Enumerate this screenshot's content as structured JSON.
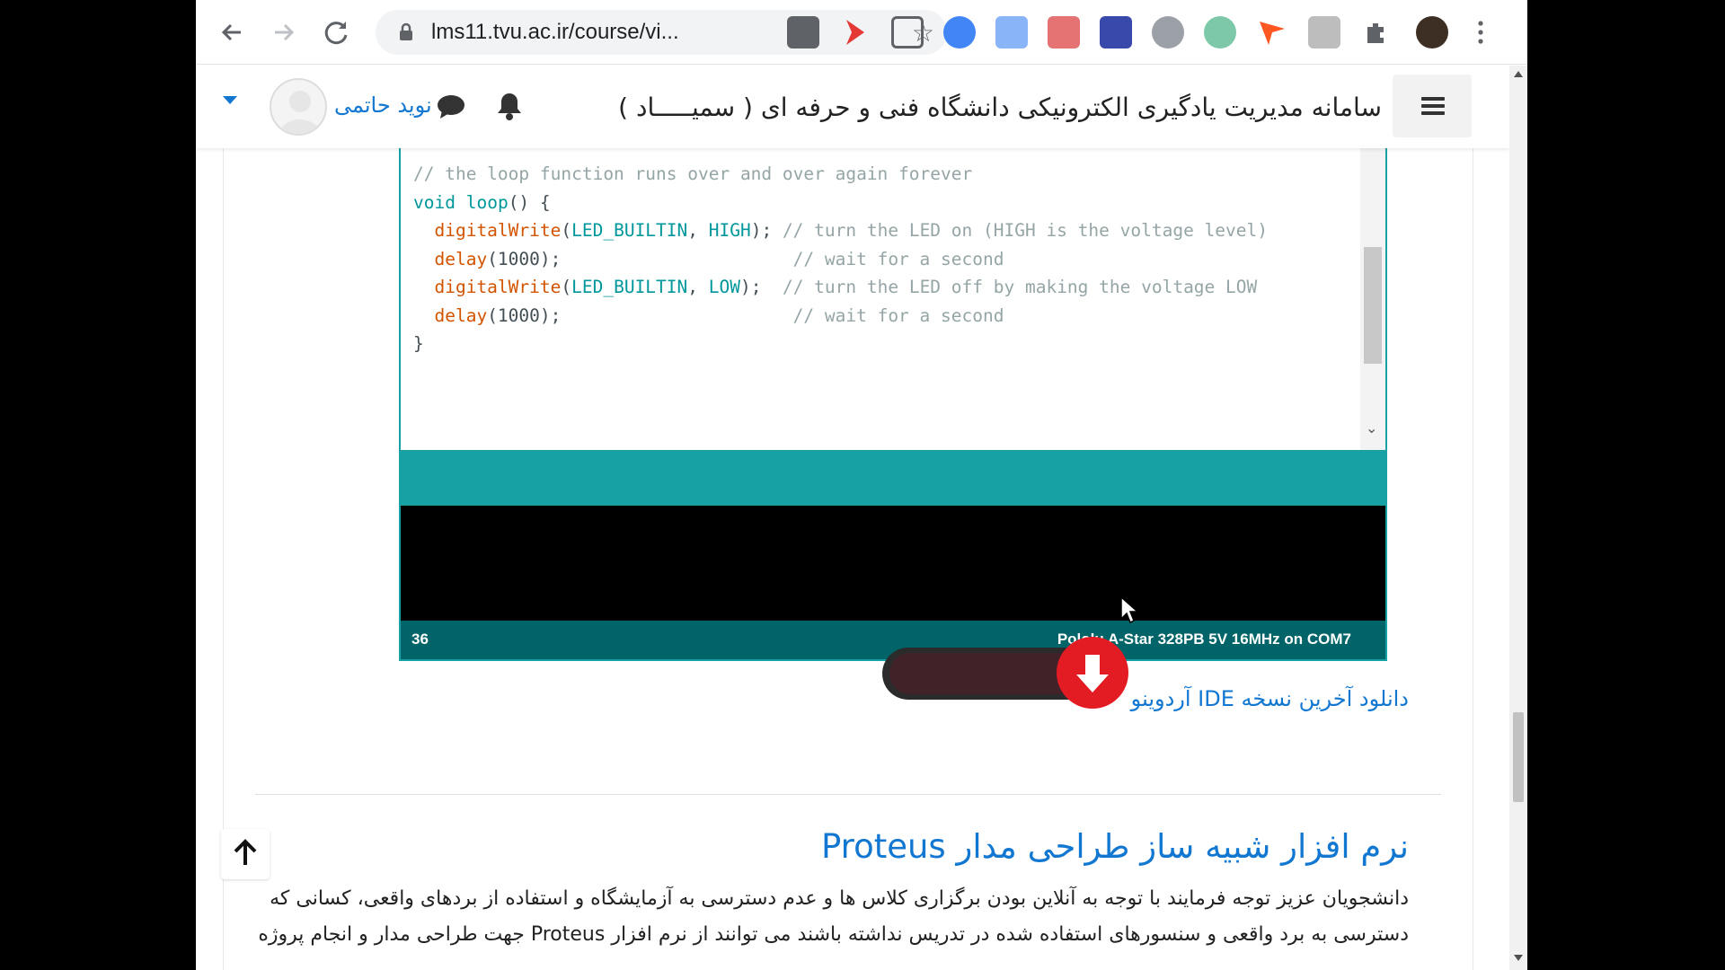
{
  "browser": {
    "url": "lms11.tvu.ac.ir/course/vi...",
    "icons": [
      "back-icon",
      "forward-icon",
      "reload-icon",
      "lock-icon",
      "star-icon",
      "extensions-icon",
      "profile-avatar",
      "more-icon"
    ]
  },
  "header": {
    "site_title": "سامانه مدیریت یادگیری الکترونیکی دانشگاه فنی و حرفه ای ( سمیـــــاد )",
    "user_name": "نوید حاتمی",
    "accent": "#1177d1"
  },
  "ide": {
    "code_lines": [
      {
        "parts": [
          {
            "t": "}",
            "c": ""
          }
        ]
      },
      {
        "parts": [
          {
            "t": "",
            "c": ""
          }
        ]
      },
      {
        "parts": [
          {
            "t": "// the loop function runs over and over again forever",
            "c": "c-comment"
          }
        ]
      },
      {
        "parts": [
          {
            "t": "void",
            "c": "c-kw"
          },
          {
            "t": " ",
            "c": ""
          },
          {
            "t": "loop",
            "c": "c-kw"
          },
          {
            "t": "() {",
            "c": ""
          }
        ]
      },
      {
        "parts": [
          {
            "t": "  ",
            "c": ""
          },
          {
            "t": "digitalWrite",
            "c": "c-fn"
          },
          {
            "t": "(",
            "c": ""
          },
          {
            "t": "LED_BUILTIN",
            "c": "c-const"
          },
          {
            "t": ", ",
            "c": ""
          },
          {
            "t": "HIGH",
            "c": "c-const"
          },
          {
            "t": ");",
            "c": ""
          },
          {
            "t": " // turn the LED on (HIGH is the voltage level)",
            "c": "c-comment"
          }
        ]
      },
      {
        "parts": [
          {
            "t": "  ",
            "c": ""
          },
          {
            "t": "delay",
            "c": "c-fn"
          },
          {
            "t": "(1000);",
            "c": ""
          },
          {
            "t": "                      // wait for a second",
            "c": "c-comment"
          }
        ]
      },
      {
        "parts": [
          {
            "t": "  ",
            "c": ""
          },
          {
            "t": "digitalWrite",
            "c": "c-fn"
          },
          {
            "t": "(",
            "c": ""
          },
          {
            "t": "LED_BUILTIN",
            "c": "c-const"
          },
          {
            "t": ", ",
            "c": ""
          },
          {
            "t": "LOW",
            "c": "c-const"
          },
          {
            "t": ");",
            "c": ""
          },
          {
            "t": "  // turn the LED off by making the voltage LOW",
            "c": "c-comment"
          }
        ]
      },
      {
        "parts": [
          {
            "t": "  ",
            "c": ""
          },
          {
            "t": "delay",
            "c": "c-fn"
          },
          {
            "t": "(1000);",
            "c": ""
          },
          {
            "t": "                      // wait for a second",
            "c": "c-comment"
          }
        ]
      },
      {
        "parts": [
          {
            "t": "}",
            "c": ""
          }
        ]
      }
    ],
    "status_line_number": "36",
    "status_board": "Pololu A-Star 328PB 5V 16MHz on COM7",
    "teal": "#17a1a5",
    "status_color": "#006468"
  },
  "download": {
    "link_text": "دانلود آخرین نسخه IDE آردوینو"
  },
  "section": {
    "heading": "نرم افزار شبیه ساز طراحی مدار Proteus",
    "paragraph_lines": [
      "دانشجویان عزیز توجه فرمایند با توجه به آنلاین بودن برگزاری کلاس ها و عدم دسترسی به آزمایشگاه و استفاده از بردهای واقعی، کسانی که",
      "دسترسی به برد واقعی و سنسورهای استفاده شده در تدریس نداشته باشند می توانند از نرم افزار  Proteus  جهت طراحی مدار و انجام پروژه"
    ]
  }
}
